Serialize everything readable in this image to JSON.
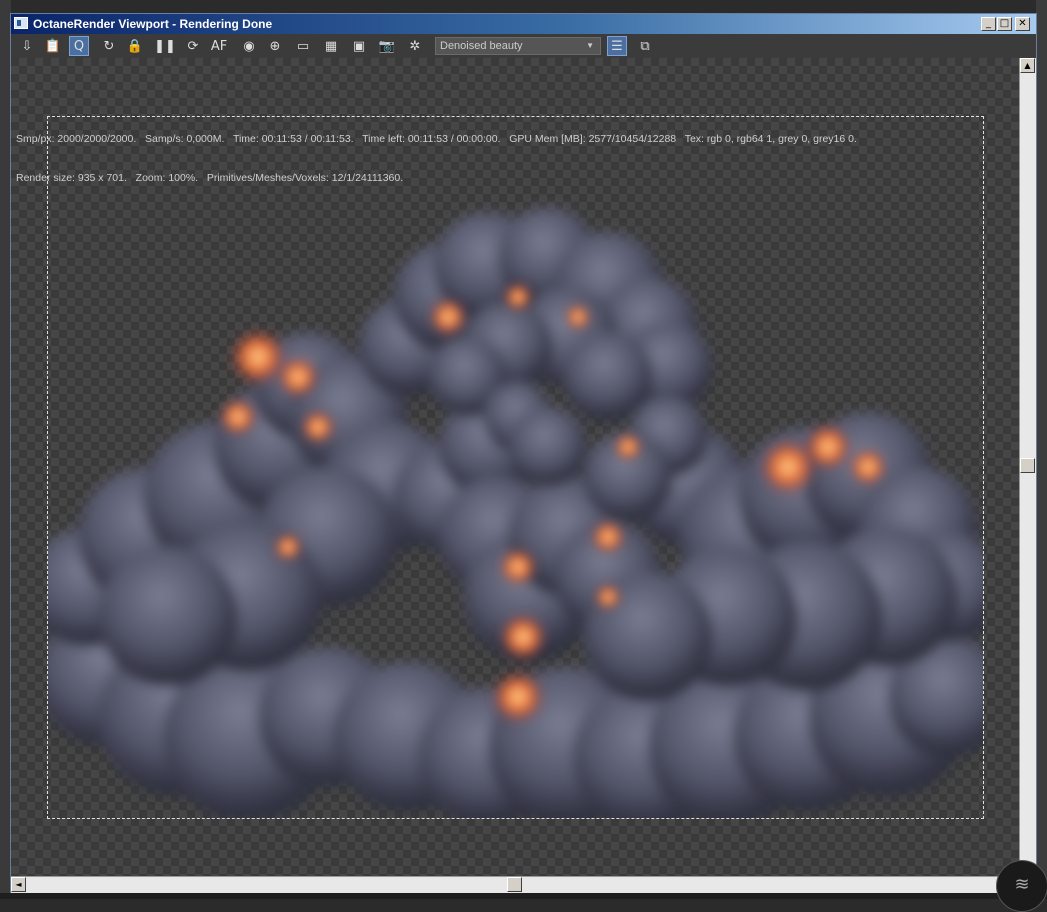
{
  "window": {
    "title": "OctaneRender Viewport - Rendering Done",
    "controls": {
      "minimize": "_",
      "maximize": "□",
      "close": "✕"
    }
  },
  "toolbar": {
    "buttons": [
      {
        "name": "send-scene-icon",
        "glyph": "⇩"
      },
      {
        "name": "clipboard-icon",
        "glyph": "📋"
      },
      {
        "name": "quick-render-icon",
        "glyph": "Q"
      },
      {
        "name": "restart-icon",
        "glyph": "↻"
      },
      {
        "name": "lock-icon",
        "glyph": "🔒"
      },
      {
        "name": "pause-icon",
        "glyph": "❚❚"
      },
      {
        "name": "refresh-icon",
        "glyph": "⟳"
      },
      {
        "name": "auto-focus-icon",
        "glyph": "AF"
      },
      {
        "name": "color-picker-icon",
        "glyph": "◉"
      },
      {
        "name": "region-icon",
        "glyph": "⊕"
      },
      {
        "name": "monitor-icon",
        "glyph": "▭"
      },
      {
        "name": "film-icon",
        "glyph": "▦"
      },
      {
        "name": "film-red-icon",
        "glyph": "▣"
      },
      {
        "name": "camera-icon",
        "glyph": "📷"
      },
      {
        "name": "settings-icon",
        "glyph": "✲"
      }
    ],
    "render_pass": "Denoised beauty",
    "right_buttons": [
      {
        "name": "table-view-icon",
        "glyph": "☰"
      },
      {
        "name": "image-view-icon",
        "glyph": "⧉"
      }
    ]
  },
  "stats": {
    "line1": "Smp/px: 2000/2000/2000.   Samp/s: 0,000M.   Time: 00:11:53 / 00:11:53.   Time left: 00:11:53 / 00:00:00.   GPU Mem [MB]: 2577/10454/12288   Tex: rgb 0, rgb64 1, grey 0, grey16 0.",
    "line2": "Render size: 935 x 701.   Zoom: 100%.   Primitives/Meshes/Voxels: 12/1/24111360."
  },
  "scrollbars": {
    "up": "▲",
    "down": "▼",
    "left": "◄",
    "right": "►"
  },
  "colors": {
    "smoke": "#5a5c6e",
    "fire": "#e0703a",
    "title_start": "#0a246a",
    "title_end": "#a6caf0"
  }
}
